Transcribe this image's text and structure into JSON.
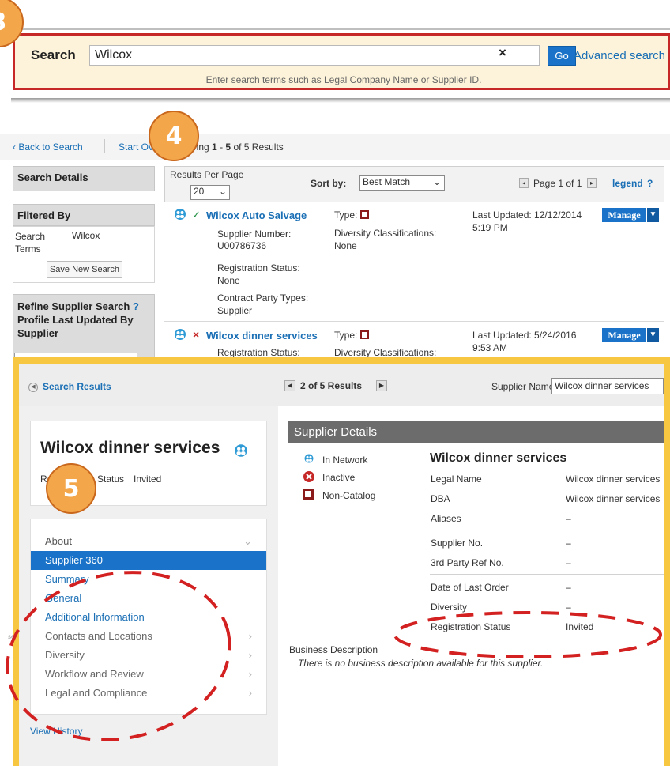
{
  "callouts": {
    "c3": "3",
    "c4": "4",
    "c5": "5"
  },
  "search": {
    "label": "Search",
    "value": "Wilcox",
    "clear_icon": "×",
    "go_label": "Go",
    "advanced_label": "Advanced search",
    "hint": "Enter search terms such as Legal Company Name or Supplier ID."
  },
  "results_nav": {
    "back": "‹ Back to Search",
    "start_over": "Start Over",
    "showing_prefix": "wing",
    "showing_from": "1",
    "showing_dash": "-",
    "showing_to": "5",
    "showing_suffix": "of 5 Results"
  },
  "left_panel": {
    "search_details_title": "Search Details",
    "filtered_by_title": "Filtered By",
    "search_terms_label": "Search Terms",
    "search_terms_value": "Wilcox",
    "save_button": "Save New Search",
    "refine_title": "Refine Supplier Search",
    "refine_help": "?",
    "profile_updated_title": "Profile Last Updated By Supplier"
  },
  "results_header": {
    "per_page_label": "Results Per Page",
    "per_page_value": "20",
    "sort_label": "Sort by:",
    "sort_value": "Best Match",
    "page_text": "Page 1 of 1",
    "legend": "legend",
    "legend_help": "?"
  },
  "results": [
    {
      "status_mark": "✓",
      "name": "Wilcox Auto Salvage",
      "type_label": "Type:",
      "f1_label": "Supplier Number:",
      "f1_value": "U00786736",
      "f2_label": "Registration Status:",
      "f2_value": "None",
      "f3_label": "Contract Party Types:",
      "f3_value": "Supplier",
      "div_label": "Diversity Classifications:",
      "div_value": "None",
      "updated_line1": "Last Updated: 12/12/2014",
      "updated_line2": "5:19 PM",
      "manage": "Manage"
    },
    {
      "status_mark": "×",
      "name": "Wilcox dinner services",
      "type_label": "Type:",
      "f1_label": "Registration Status:",
      "div_label": "Diversity Classifications:",
      "updated_line1": "Last Updated: 5/24/2016",
      "updated_line2": "9:53 AM",
      "manage": "Manage"
    }
  ],
  "detail": {
    "back_link": "Search Results",
    "pager_text": "2 of 5 Results",
    "supplier_name_label": "Supplier Name",
    "supplier_name_value": "Wilcox dinner services",
    "title": "Wilcox dinner services",
    "reg_label_a": "Re",
    "reg_label_b": "Status",
    "reg_value": "Invited",
    "nav": {
      "about": "About",
      "supplier360": "Supplier 360",
      "summary": "Summary",
      "general": "General",
      "additional": "Additional Information",
      "contacts": "Contacts and Locations",
      "diversity": "Diversity",
      "workflow": "Workflow and Review",
      "legal": "Legal and Compliance"
    },
    "view_history": "View History",
    "side_label": "ser",
    "supplier_details_title": "Supplier Details",
    "legend_items": [
      "In Network",
      "Inactive",
      "Non-Catalog"
    ],
    "details_title": "Wilcox dinner services",
    "rows": [
      {
        "label": "Legal Name",
        "value": "Wilcox dinner services"
      },
      {
        "label": "DBA",
        "value": "Wilcox dinner services"
      },
      {
        "label": "Aliases",
        "value": "–"
      },
      {
        "label": "Supplier No.",
        "value": "–"
      },
      {
        "label": "3rd Party Ref No.",
        "value": "–"
      },
      {
        "label": "Date of Last Order",
        "value": "–"
      },
      {
        "label": "Diversity",
        "value": "–"
      },
      {
        "label": "Registration Status",
        "value": "Invited"
      }
    ],
    "business_desc_label": "Business Description",
    "business_desc_text": "There is no business description available for this supplier."
  },
  "colors": {
    "accent": "#1a73c8",
    "highlight_border": "#f7c742",
    "annotation_red": "#d32020",
    "callout": "#f4a64a"
  }
}
